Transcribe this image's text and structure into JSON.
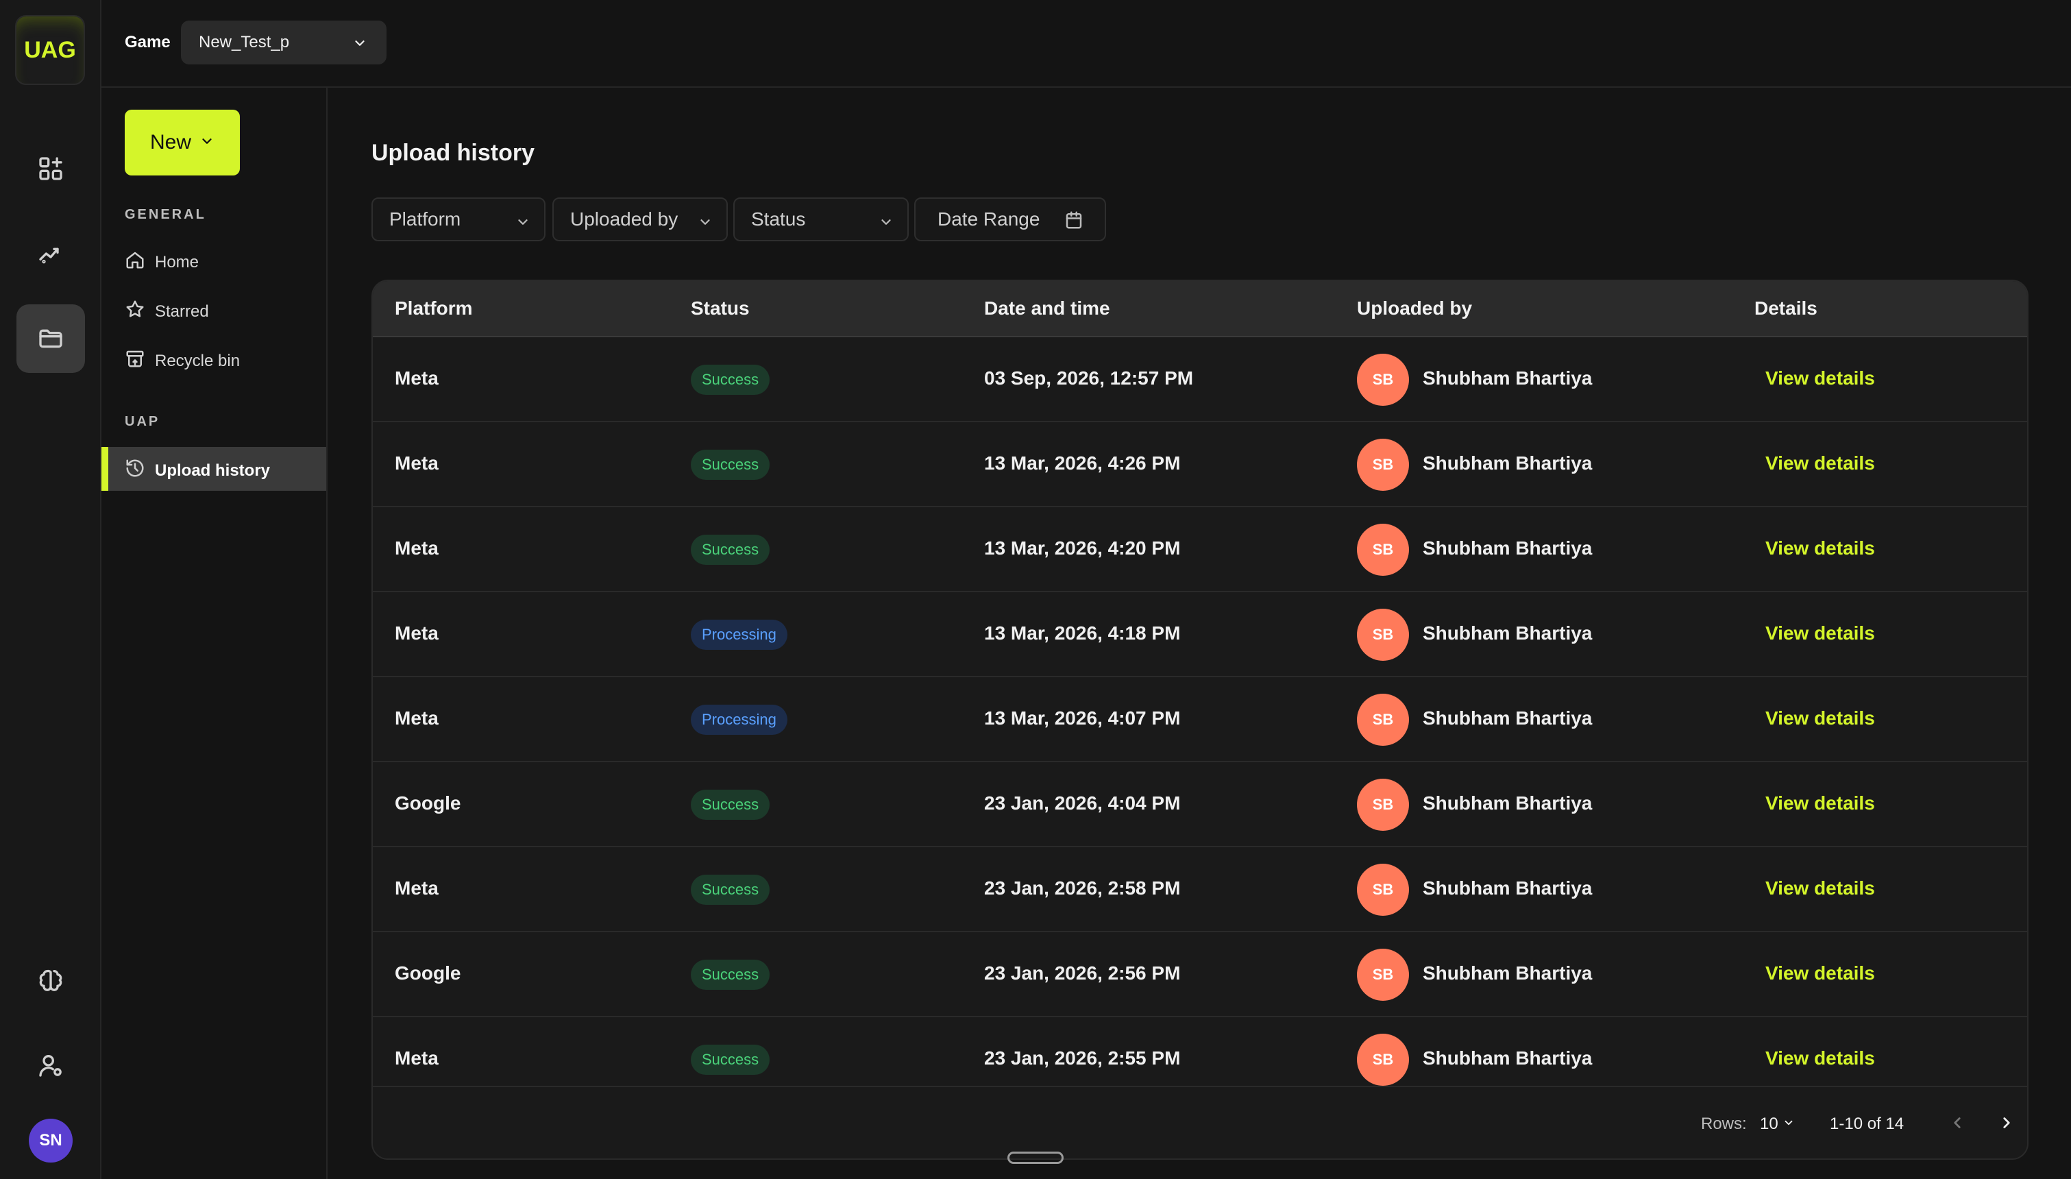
{
  "brand": {
    "logo_text": "UAG",
    "accent": "#d4f52a"
  },
  "rail": {
    "icons": [
      "apps-icon",
      "analytics-icon",
      "folder-icon",
      "brain-icon",
      "user-settings-icon"
    ],
    "active": "folder-icon",
    "user_initials": "SN"
  },
  "topbar": {
    "game_label": "Game",
    "game_value": "New_Test_p"
  },
  "sidebar": {
    "new_label": "New",
    "general_label": "GENERAL",
    "general_items": [
      {
        "label": "Home",
        "icon": "home-icon"
      },
      {
        "label": "Starred",
        "icon": "star-icon"
      },
      {
        "label": "Recycle bin",
        "icon": "recycle-bin-icon"
      }
    ],
    "uap_label": "UAP",
    "uap_items": [
      {
        "label": "Upload history",
        "icon": "history-icon",
        "active": true
      }
    ]
  },
  "main": {
    "title": "Upload history",
    "filters": {
      "platform": "Platform",
      "uploaded_by": "Uploaded by",
      "status": "Status",
      "date_range": "Date Range"
    },
    "columns": [
      "Platform",
      "Status",
      "Date and time",
      "Uploaded by",
      "Details"
    ],
    "rows": [
      {
        "platform": "Meta",
        "status": "Success",
        "status_kind": "success",
        "date": "03 Sep, 2026, 12:57 PM",
        "initials": "SB",
        "uploader": "Shubham Bhartiya",
        "details": "View details"
      },
      {
        "platform": "Meta",
        "status": "Success",
        "status_kind": "success",
        "date": "13 Mar, 2026, 4:26 PM",
        "initials": "SB",
        "uploader": "Shubham Bhartiya",
        "details": "View details"
      },
      {
        "platform": "Meta",
        "status": "Success",
        "status_kind": "success",
        "date": "13 Mar, 2026, 4:20 PM",
        "initials": "SB",
        "uploader": "Shubham Bhartiya",
        "details": "View details"
      },
      {
        "platform": "Meta",
        "status": "Processing",
        "status_kind": "processing",
        "date": "13 Mar, 2026, 4:18 PM",
        "initials": "SB",
        "uploader": "Shubham Bhartiya",
        "details": "View details"
      },
      {
        "platform": "Meta",
        "status": "Processing",
        "status_kind": "processing",
        "date": "13 Mar, 2026, 4:07 PM",
        "initials": "SB",
        "uploader": "Shubham Bhartiya",
        "details": "View details"
      },
      {
        "platform": "Google",
        "status": "Success",
        "status_kind": "success",
        "date": "23 Jan, 2026, 4:04 PM",
        "initials": "SB",
        "uploader": "Shubham Bhartiya",
        "details": "View details"
      },
      {
        "platform": "Meta",
        "status": "Success",
        "status_kind": "success",
        "date": "23 Jan, 2026, 2:58 PM",
        "initials": "SB",
        "uploader": "Shubham Bhartiya",
        "details": "View details"
      },
      {
        "platform": "Google",
        "status": "Success",
        "status_kind": "success",
        "date": "23 Jan, 2026, 2:56 PM",
        "initials": "SB",
        "uploader": "Shubham Bhartiya",
        "details": "View details"
      },
      {
        "platform": "Meta",
        "status": "Success",
        "status_kind": "success",
        "date": "23 Jan, 2026, 2:55 PM",
        "initials": "SB",
        "uploader": "Shubham Bhartiya",
        "details": "View details"
      }
    ],
    "pagination": {
      "rows_label": "Rows:",
      "rows_value": "10",
      "range": "1-10 of 14"
    }
  }
}
